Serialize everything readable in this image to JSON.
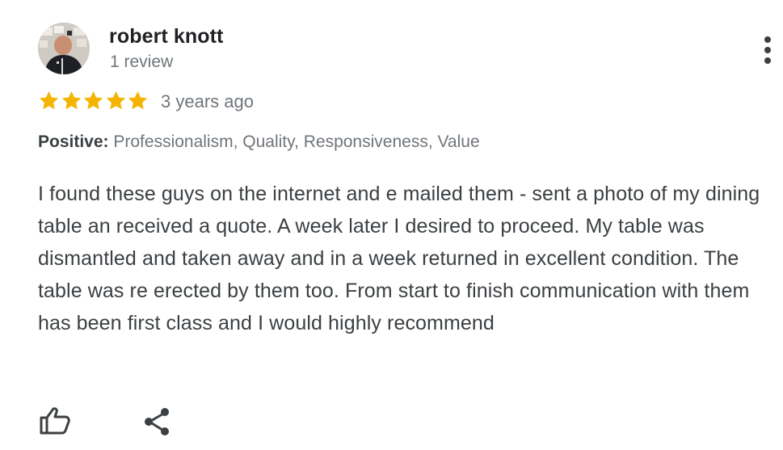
{
  "reviewer": {
    "name": "robert knott",
    "review_count": "1 review",
    "avatar_icon": "user-photo"
  },
  "menu": {
    "icon": "more-vert-icon"
  },
  "rating": {
    "stars": 5,
    "max_stars": 5,
    "star_color": "#f4b400",
    "time": "3 years ago"
  },
  "attributes": {
    "label": "Positive:",
    "values": "Professionalism, Quality, Responsiveness, Value"
  },
  "review": {
    "text": "I found these guys on the internet and e mailed them - sent a photo of my dining table an received a quote. A week later I desired to proceed. My table was dismantled and taken away and in a week returned in excellent condition. The table was re erected by them too. From start to finish communication with them has been first class and I would highly recommend"
  },
  "actions": {
    "like_icon": "thumb-up-icon",
    "share_icon": "share-icon"
  }
}
